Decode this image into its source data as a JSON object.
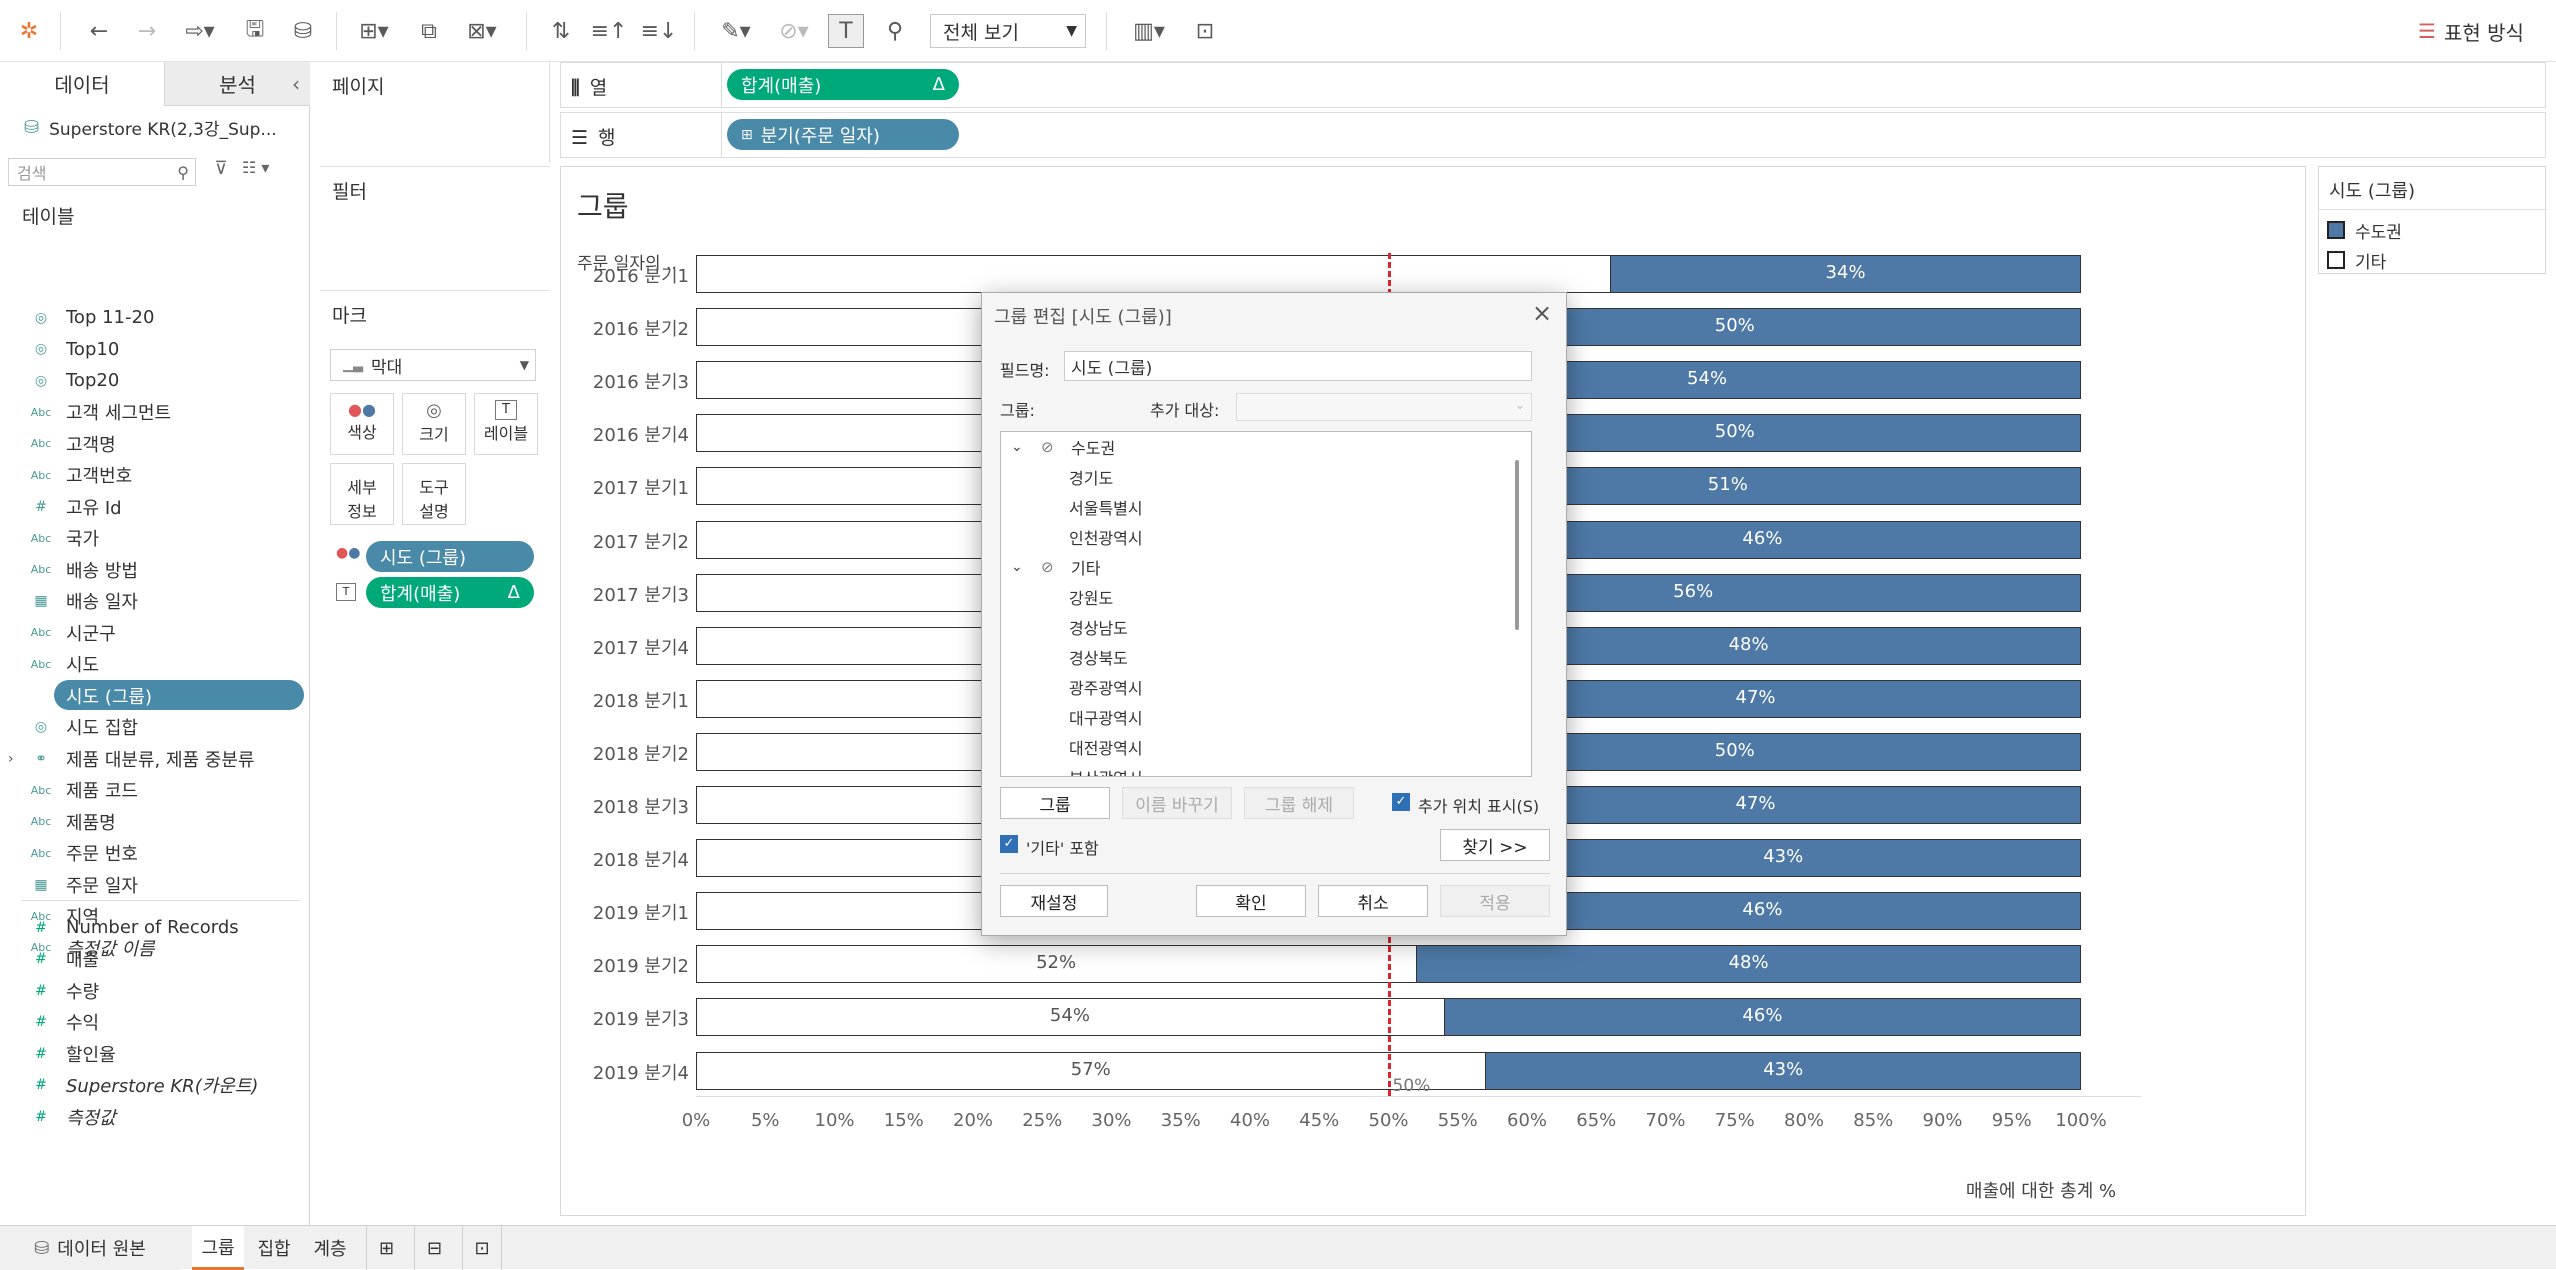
{
  "toolbar": {
    "view_dropdown": "전체 보기",
    "show_me": "표현 방식"
  },
  "left_panel": {
    "tab_data": "데이터",
    "tab_analysis": "분석",
    "datasource": "Superstore KR(2,3강_Sup...",
    "search_placeholder": "검색",
    "tables_header": "테이블",
    "fields": [
      {
        "type": "set",
        "label": "Top 11-20"
      },
      {
        "type": "set",
        "label": "Top10"
      },
      {
        "type": "set",
        "label": "Top20"
      },
      {
        "type": "Abc",
        "label": "고객 세그먼트"
      },
      {
        "type": "Abc",
        "label": "고객명"
      },
      {
        "type": "Abc",
        "label": "고객번호"
      },
      {
        "type": "#",
        "label": "고유 Id"
      },
      {
        "type": "Abc",
        "label": "국가"
      },
      {
        "type": "Abc",
        "label": "배송 방법"
      },
      {
        "type": "date",
        "label": "배송 일자"
      },
      {
        "type": "Abc",
        "label": "시군구"
      },
      {
        "type": "Abc",
        "label": "시도"
      },
      {
        "type": "group",
        "label": "시도 (그룹)"
      },
      {
        "type": "set",
        "label": "시도 집합"
      },
      {
        "type": "hier",
        "label": "제품 대분류, 제품 중분류"
      },
      {
        "type": "Abc",
        "label": "제품 코드"
      },
      {
        "type": "Abc",
        "label": "제품명"
      },
      {
        "type": "Abc",
        "label": "주문 번호"
      },
      {
        "type": "date",
        "label": "주문 일자"
      },
      {
        "type": "Abc",
        "label": "지역"
      },
      {
        "type": "Abc",
        "label": "측정값 이름"
      }
    ],
    "measures": [
      {
        "type": "#",
        "label": "Number of Records"
      },
      {
        "type": "#",
        "label": "매출"
      },
      {
        "type": "#",
        "label": "수량"
      },
      {
        "type": "#",
        "label": "수익"
      },
      {
        "type": "#",
        "label": "할인율"
      },
      {
        "type": "#",
        "label": "Superstore KR(카운트)"
      },
      {
        "type": "#",
        "label": "측정값"
      }
    ]
  },
  "cards": {
    "pages": "페이지",
    "filters": "필터",
    "marks": "마크",
    "mark_type": "막대",
    "color": "색상",
    "size": "크기",
    "label": "레이블",
    "detail_1": "세부",
    "detail_2": "정보",
    "tooltip_1": "도구",
    "tooltip_2": "설명",
    "pill_color": "시도 (그룹)",
    "pill_label": "합계(매출)",
    "delta": "Δ"
  },
  "shelves": {
    "columns_label": "열",
    "rows_label": "행",
    "columns_pill": "합계(매출)",
    "rows_pill": "분기(주문 일자)"
  },
  "view": {
    "title": "그룹",
    "row_header": "주문 일자의 ..",
    "reference_label": "50%",
    "axis_label": "매출에 대한 총계 %"
  },
  "legend": {
    "title": "시도 (그룹)",
    "items": [
      {
        "label": "수도권",
        "color": "#4e79a7"
      },
      {
        "label": "기타",
        "color": "#ffffff"
      }
    ]
  },
  "chart_data": {
    "type": "bar",
    "categories": [
      "2016 분기1",
      "2016 분기2",
      "2016 분기3",
      "2016 분기4",
      "2017 분기1",
      "2017 분기2",
      "2017 분기3",
      "2017 분기4",
      "2018 분기1",
      "2018 분기2",
      "2018 분기3",
      "2018 분기4",
      "2019 분기1",
      "2019 분기2",
      "2019 분기3",
      "2019 분기4"
    ],
    "series": [
      {
        "name": "기타",
        "values": [
          66,
          50,
          46,
          50,
          49,
          54,
          44,
          52,
          53,
          50,
          53,
          57,
          54,
          52,
          54,
          57
        ],
        "labels": [
          "",
          "",
          "",
          "",
          "",
          "",
          "",
          "",
          "",
          "",
          "",
          "",
          "54%",
          "52%",
          "54%",
          "57%"
        ]
      },
      {
        "name": "수도권",
        "values": [
          34,
          50,
          54,
          50,
          51,
          46,
          56,
          48,
          47,
          50,
          47,
          43,
          46,
          48,
          46,
          43
        ],
        "labels": [
          "34%",
          "50%",
          "54%",
          "50%",
          "51%",
          "46%",
          "56%",
          "48%",
          "47%",
          "50%",
          "47%",
          "43%",
          "46%",
          "48%",
          "46%",
          "43%"
        ]
      }
    ],
    "xticks": [
      "0%",
      "5%",
      "10%",
      "15%",
      "20%",
      "25%",
      "30%",
      "35%",
      "40%",
      "45%",
      "50%",
      "55%",
      "60%",
      "65%",
      "70%",
      "75%",
      "80%",
      "85%",
      "90%",
      "95%",
      "100%"
    ],
    "xlim": [
      0,
      100
    ],
    "xlabel": "매출에 대한 총계 %",
    "reference_line": 50,
    "stacked": true,
    "orientation": "horizontal"
  },
  "dialog": {
    "title": "그룹 편집 [시도 (그룹)]",
    "field_name_label": "필드명:",
    "field_name_value": "시도 (그룹)",
    "group_label": "그룹:",
    "add_to_label": "추가 대상:",
    "tree": [
      {
        "kind": "group",
        "label": "수도권"
      },
      {
        "kind": "item",
        "label": "경기도"
      },
      {
        "kind": "item",
        "label": "서울특별시"
      },
      {
        "kind": "item",
        "label": "인천광역시"
      },
      {
        "kind": "group",
        "label": "기타"
      },
      {
        "kind": "item",
        "label": "강원도"
      },
      {
        "kind": "item",
        "label": "경상남도"
      },
      {
        "kind": "item",
        "label": "경상북도"
      },
      {
        "kind": "item",
        "label": "광주광역시"
      },
      {
        "kind": "item",
        "label": "대구광역시"
      },
      {
        "kind": "item",
        "label": "대전광역시"
      },
      {
        "kind": "item",
        "label": "부산광역시"
      }
    ],
    "btn_group": "그룹",
    "btn_rename": "이름 바꾸기",
    "btn_ungroup": "그룹 해제",
    "show_add_location": "추가 위치 표시(S)",
    "include_other": "'기타' 포함",
    "btn_find": "찾기 >>",
    "btn_reset": "재설정",
    "btn_ok": "확인",
    "btn_cancel": "취소",
    "btn_apply": "적용"
  },
  "bottom_tabs": {
    "datasource": "데이터 원본",
    "sheets": [
      "그룹",
      "집합",
      "계층"
    ]
  }
}
